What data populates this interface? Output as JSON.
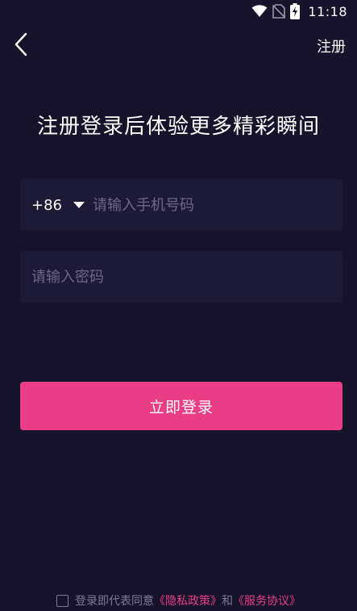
{
  "status_bar": {
    "time": "11:18",
    "icons": [
      "wifi-icon",
      "no-sim-icon",
      "battery-charging-icon"
    ]
  },
  "header": {
    "back_icon": "chevron-left-icon",
    "register_label": "注册"
  },
  "headline": "注册登录后体验更多精彩瞬间",
  "phone": {
    "country_code": "+86",
    "dropdown_icon": "caret-down-icon",
    "placeholder": "请输入手机号码",
    "value": ""
  },
  "password": {
    "placeholder": "请输入密码",
    "value": ""
  },
  "login_button_label": "立即登录",
  "agreement": {
    "checked": false,
    "prefix": "登录即代表同意",
    "privacy_link": "《隐私政策》",
    "conjunction": "和",
    "terms_link": "《服务协议》"
  },
  "colors": {
    "background": "#16132a",
    "field_background": "#1d1a36",
    "accent": "#e93e86",
    "muted_text": "#7d7a96"
  }
}
